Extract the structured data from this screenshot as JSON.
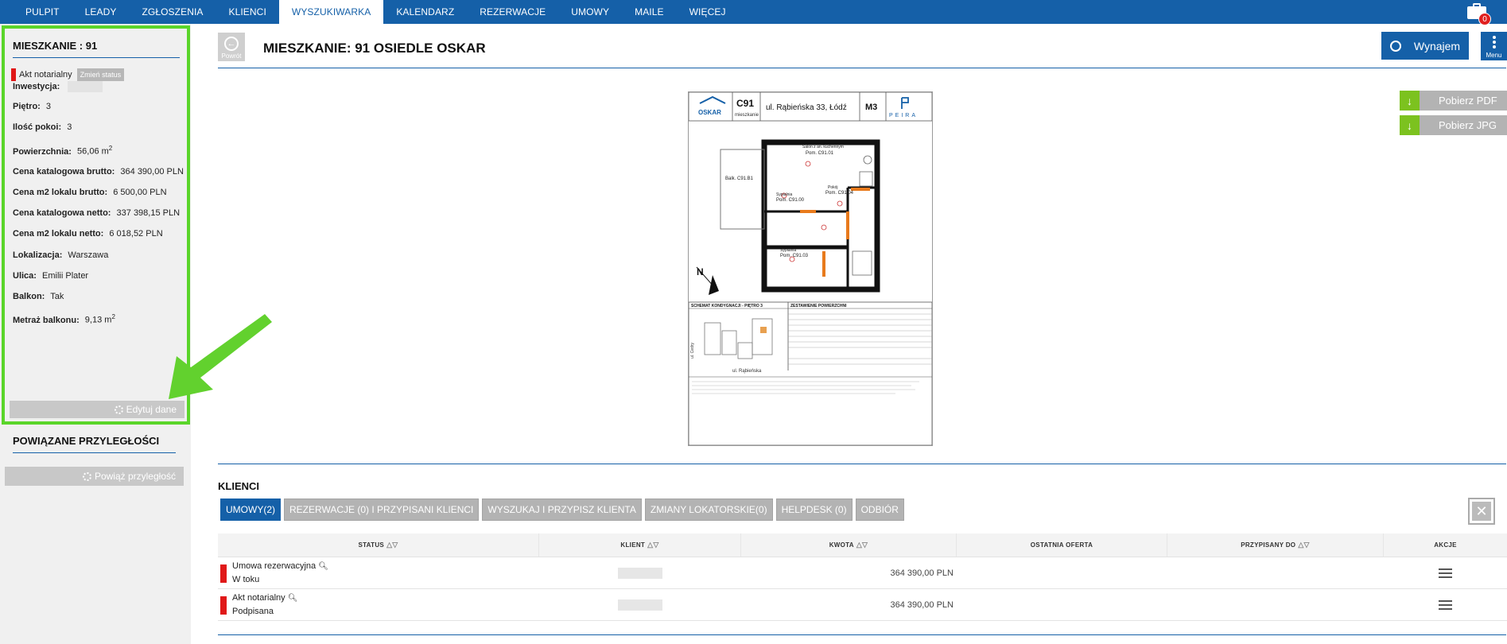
{
  "nav": {
    "items": [
      "PULPIT",
      "LEADY",
      "ZGŁOSZENIA",
      "KLIENCI",
      "WYSZUKIWARKA",
      "KALENDARZ",
      "REZERWACJE",
      "UMOWY",
      "MAILE",
      "WIĘCEJ"
    ],
    "active": "WYSZUKIWARKA",
    "notifications": "0"
  },
  "sidebar": {
    "title": "MIESZKANIE : 91",
    "status": "Akt notarialny",
    "status_button": "Zmień status",
    "fields": {
      "inwestycja_label": "Inwestycja:",
      "pietro_label": "Piętro:",
      "pietro": "3",
      "pokoje_label": "Ilość pokoi:",
      "pokoje": "3",
      "powierzchnia_label": "Powierzchnia:",
      "powierzchnia": "56,06 m",
      "brutto_label": "Cena katalogowa brutto:",
      "brutto": "364 390,00 PLN",
      "m2_brutto_label": "Cena m2 lokalu brutto:",
      "m2_brutto": "6 500,00 PLN",
      "netto_label": "Cena katalogowa netto:",
      "netto": "337 398,15 PLN",
      "m2_netto_label": "Cena m2 lokalu netto:",
      "m2_netto": "6 018,52 PLN",
      "lokalizacja_label": "Lokalizacja:",
      "lokalizacja": "Warszawa",
      "ulica_label": "Ulica:",
      "ulica": "Emilii Plater",
      "balkon_label": "Balkon:",
      "balkon": "Tak",
      "metraz_label": "Metraż balkonu:",
      "metraz": "9,13 m",
      "sup": "2"
    },
    "edit_button": "Edytuj dane",
    "related_title": "POWIĄZANE PRZYLEGŁOŚCI",
    "related_button": "Powiąż przyległość"
  },
  "header": {
    "back": "Powrót",
    "title": "MIESZKANIE: 91 OSIEDLE OSKAR",
    "wynajem": "Wynajem",
    "menu": "Menu",
    "pdf": "Pobierz PDF",
    "jpg": "Pobierz JPG"
  },
  "plan": {
    "unit": "C91",
    "unit_sub": "mieszkanie",
    "address": "ul. Rąbieńska 33, Łódź",
    "type": "M3",
    "brand": "PEIRA",
    "logo": "OSKAR",
    "schema": "SCHEMAT KONDYGNACJI - PIĘTRO 3",
    "summary": "ZESTAWIENIE POWIERZCHNI",
    "street_a": "ul. Cedry",
    "street_b": "ul. Rąbieńska",
    "rooms": [
      "Salon z an. kuchennym",
      "Pom. C91.01",
      "Pokój",
      "Pom. C91.04",
      "Sypialnia",
      "Pom. C91.00",
      "Sypialnia",
      "Pom. C91.03",
      "Balk. C91.B1",
      "N"
    ]
  },
  "clients": {
    "title": "KLIENCI",
    "tabs": [
      "UMOWY(2)",
      "REZERWACJE (0) I PRZYPISANI KLIENCI",
      "WYSZUKAJ I PRZYPISZ KLIENTA",
      "ZMIANY LOKATORSKIE(0)",
      "HELPDESK (0)",
      "ODBIÓR"
    ],
    "columns": [
      "STATUS",
      "KLIENT",
      "KWOTA",
      "OSTATNIA OFERTA",
      "PRZYPISANY DO",
      "AKCJE"
    ],
    "rows": [
      {
        "status": "Umowa rezerwacyjna",
        "sub": "W toku",
        "kwota": "364 390,00 PLN"
      },
      {
        "status": "Akt notarialny",
        "sub": "Podpisana",
        "kwota": "364 390,00 PLN"
      }
    ]
  },
  "colors": {
    "nav": "#1560a8",
    "highlight": "#5ad52a",
    "status_red": "#e01818",
    "download": "#7cc21f"
  }
}
